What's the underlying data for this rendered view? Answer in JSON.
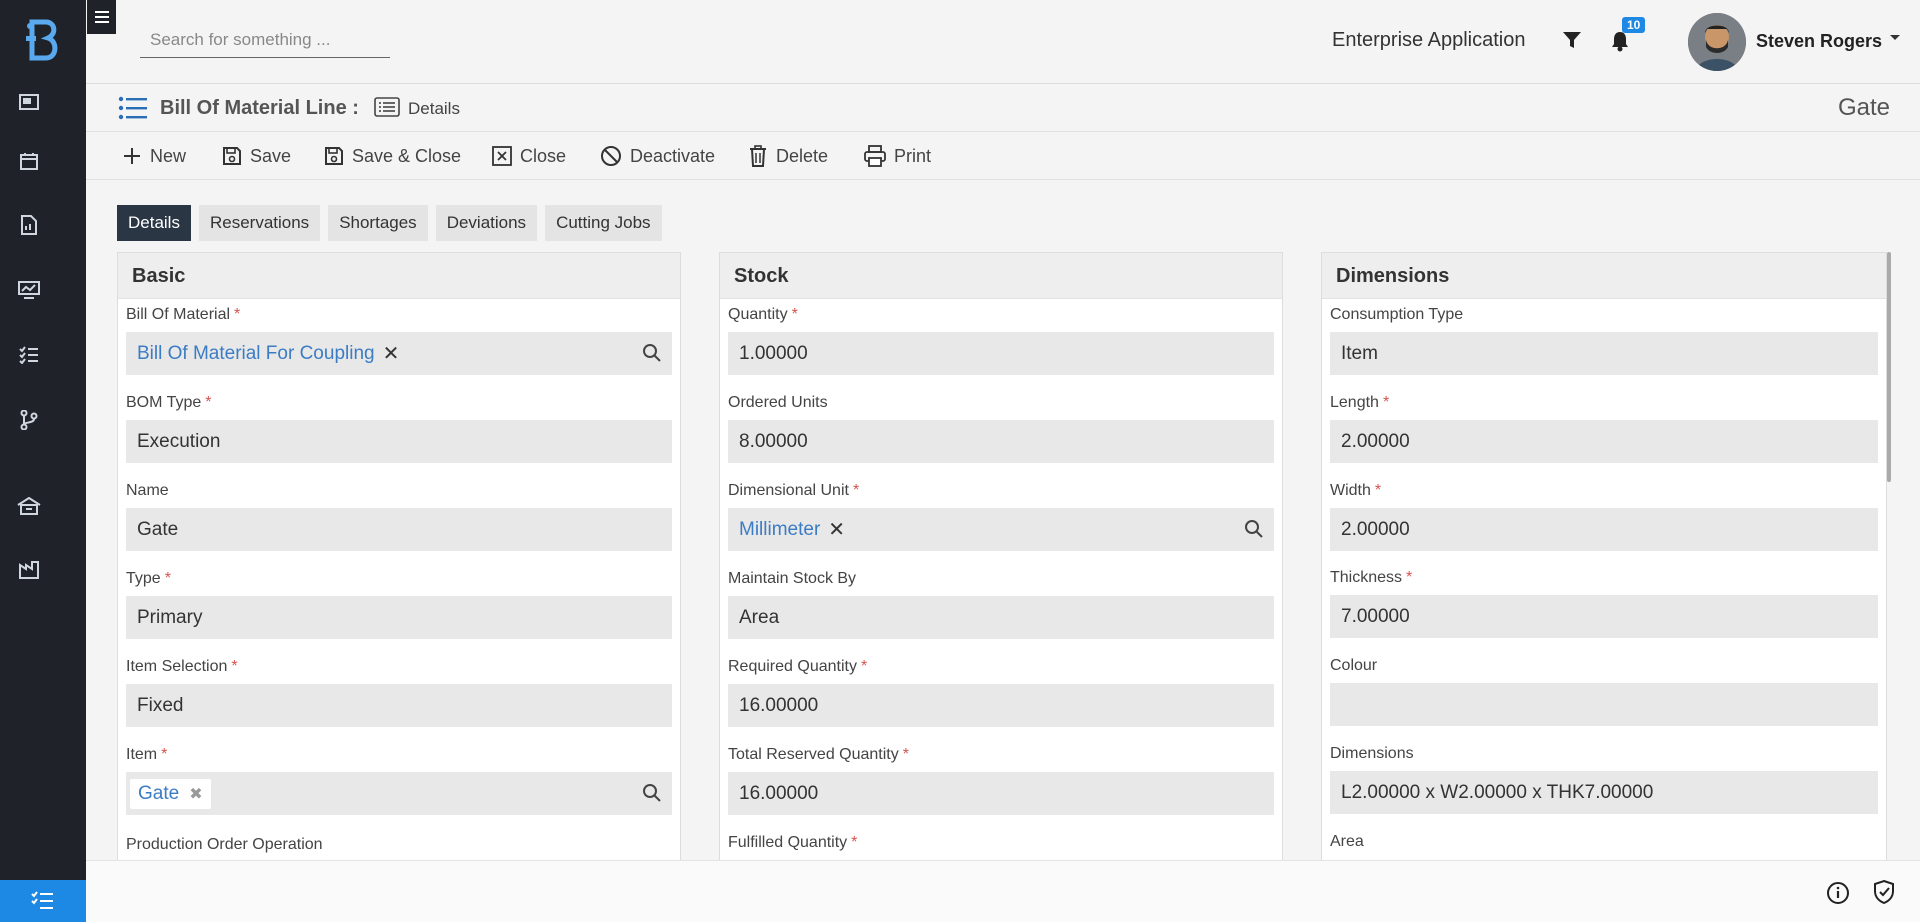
{
  "topbar": {
    "search_placeholder": "Search for something ...",
    "app_name": "Enterprise Application",
    "notification_count": "10",
    "user_name": "Steven Rogers"
  },
  "breadcrumb": {
    "title": "Bill Of Material Line :",
    "section": "Details",
    "record_name": "Gate"
  },
  "toolbar": {
    "new_label": "New",
    "save_label": "Save",
    "save_close_label": "Save & Close",
    "close_label": "Close",
    "deactivate_label": "Deactivate",
    "delete_label": "Delete",
    "print_label": "Print"
  },
  "tabs": [
    {
      "label": "Details",
      "active": true
    },
    {
      "label": "Reservations"
    },
    {
      "label": "Shortages"
    },
    {
      "label": "Deviations"
    },
    {
      "label": "Cutting Jobs"
    }
  ],
  "basic": {
    "title": "Basic",
    "bill_of_material": {
      "label": "Bill Of Material",
      "value": "Bill Of Material For Coupling"
    },
    "bom_type": {
      "label": "BOM Type",
      "value": "Execution"
    },
    "name": {
      "label": "Name",
      "value": "Gate"
    },
    "type": {
      "label": "Type",
      "value": "Primary"
    },
    "item_selection": {
      "label": "Item Selection",
      "value": "Fixed"
    },
    "item": {
      "label": "Item",
      "value": "Gate"
    },
    "production_order_operation": {
      "label": "Production Order Operation"
    }
  },
  "stock": {
    "title": "Stock",
    "quantity": {
      "label": "Quantity",
      "value": "1.00000"
    },
    "ordered_units": {
      "label": "Ordered Units",
      "value": "8.00000"
    },
    "dimensional_unit": {
      "label": "Dimensional Unit",
      "value": "Millimeter"
    },
    "maintain_stock_by": {
      "label": "Maintain Stock By",
      "value": "Area"
    },
    "required_quantity": {
      "label": "Required Quantity",
      "value": "16.00000"
    },
    "total_reserved_quantity": {
      "label": "Total Reserved Quantity",
      "value": "16.00000"
    },
    "fulfilled_quantity": {
      "label": "Fulfilled Quantity"
    }
  },
  "dimensions": {
    "title": "Dimensions",
    "consumption_type": {
      "label": "Consumption Type",
      "value": "Item"
    },
    "length": {
      "label": "Length",
      "value": "2.00000"
    },
    "width": {
      "label": "Width",
      "value": "2.00000"
    },
    "thickness": {
      "label": "Thickness",
      "value": "7.00000"
    },
    "colour": {
      "label": "Colour",
      "value": ""
    },
    "dimensions": {
      "label": "Dimensions",
      "value": "L2.00000 x W2.00000 x THK7.00000"
    },
    "area": {
      "label": "Area"
    }
  },
  "colors": {
    "rail": "#1f2329",
    "accent": "#1e88e5",
    "link": "#3b7cc4",
    "active_tab": "#2a3644",
    "required": "#d9534f"
  }
}
